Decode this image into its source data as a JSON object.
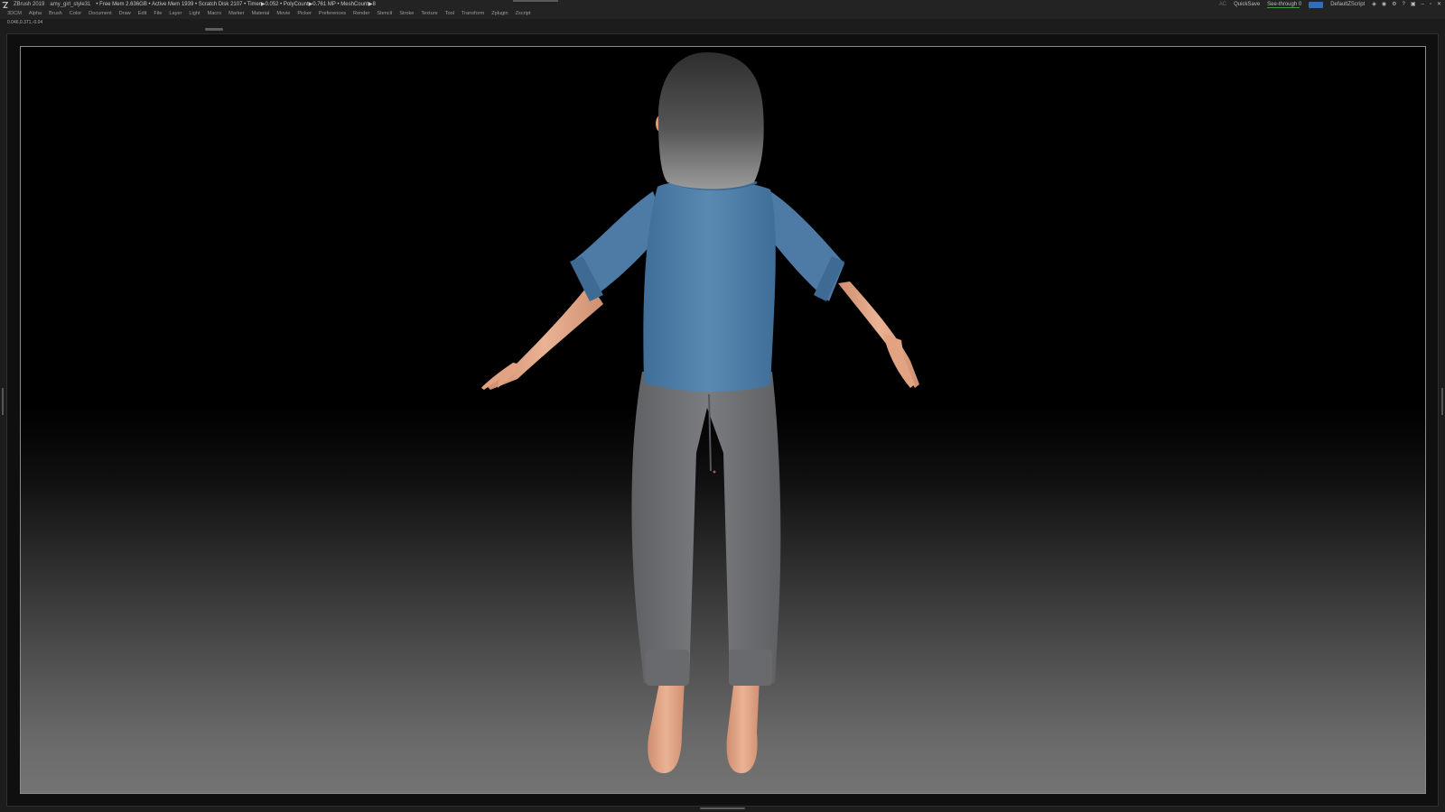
{
  "titlebar": {
    "app_name": "ZBrush 2019",
    "document_name": "amy_girl_style31",
    "stats": "• Free Mem 2.636GB • Active Mem 1939 • Scratch Disk 2107 • Timer▶0.052 • PolyCount▶0.761 MP • MeshCount▶8",
    "ac_label": "AC",
    "quicksave_label": "QuickSave",
    "seethrough_label": "See-through 0",
    "menus_label": "Menus",
    "script_label": "DefaultZScript"
  },
  "menubar": {
    "items": [
      "3DCM",
      "Alpha",
      "Brush",
      "Color",
      "Document",
      "Draw",
      "Edit",
      "File",
      "Layer",
      "Light",
      "Macro",
      "Marker",
      "Material",
      "Movie",
      "Picker",
      "Preferences",
      "Render",
      "Stencil",
      "Stroke",
      "Texture",
      "Tool",
      "Transform",
      "Zplugin",
      "Zscript"
    ]
  },
  "readout": {
    "coordinates": "0.046,0.371,-0.04"
  },
  "colors": {
    "shirt": "#4f7da6",
    "pants": "#6c6e72",
    "hair": "#3e3e3e",
    "skin": "#e4a787",
    "accent_blue": "#2f6fb3",
    "seethrough_green": "#3b9a3b"
  },
  "icons": {
    "app_logo": "zbrush-logo-icon",
    "window_controls": [
      "minimize-icon",
      "restore-icon",
      "close-icon"
    ]
  }
}
